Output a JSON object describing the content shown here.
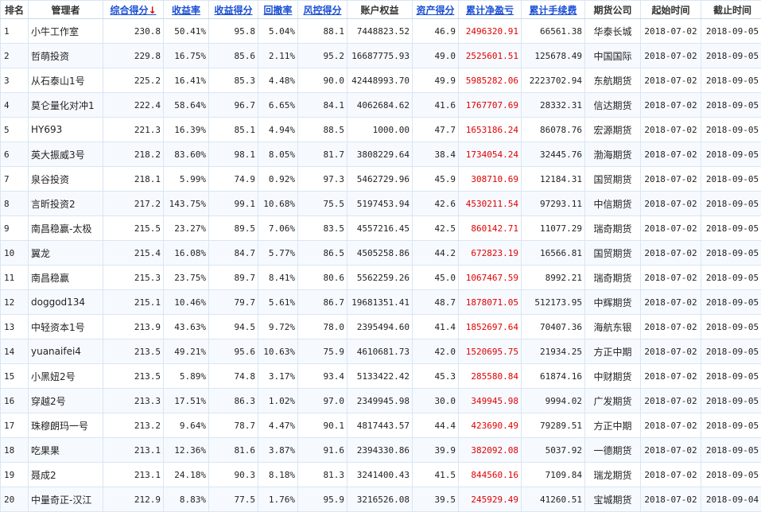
{
  "colors": {
    "accent": "#1a4fd6",
    "highlight": "#e00000",
    "row_alt": "#f6faff",
    "border": "#d9e6f2"
  },
  "table": {
    "headers": [
      {
        "label": "排名",
        "sortable": false
      },
      {
        "label": "管理者",
        "sortable": false
      },
      {
        "label": "综合得分",
        "sortable": true,
        "sort_arrow": "↓"
      },
      {
        "label": "收益率",
        "sortable": true
      },
      {
        "label": "收益得分",
        "sortable": true
      },
      {
        "label": "回撤率",
        "sortable": true
      },
      {
        "label": "风控得分",
        "sortable": true
      },
      {
        "label": "账户权益",
        "sortable": false
      },
      {
        "label": "资产得分",
        "sortable": true
      },
      {
        "label": "累计净盈亏",
        "sortable": true
      },
      {
        "label": "累计手续费",
        "sortable": true
      },
      {
        "label": "期货公司",
        "sortable": false
      },
      {
        "label": "起始时间",
        "sortable": false
      },
      {
        "label": "截止时间",
        "sortable": false
      }
    ],
    "rows": [
      [
        "1",
        "小牛工作室",
        "230.8",
        "50.41%",
        "95.8",
        "5.04%",
        "88.1",
        "7448823.52",
        "46.9",
        "2496320.91",
        "66561.38",
        "华泰长城",
        "2018-07-02",
        "2018-09-05"
      ],
      [
        "2",
        "哲萌投资",
        "229.8",
        "16.75%",
        "85.6",
        "2.11%",
        "95.2",
        "16687775.93",
        "49.0",
        "2525601.51",
        "125678.49",
        "中国国际",
        "2018-07-02",
        "2018-09-05"
      ],
      [
        "3",
        "从石泰山1号",
        "225.2",
        "16.41%",
        "85.3",
        "4.48%",
        "90.0",
        "42448993.70",
        "49.9",
        "5985282.06",
        "2223702.94",
        "东航期货",
        "2018-07-02",
        "2018-09-05"
      ],
      [
        "4",
        "莫仑量化对冲1",
        "222.4",
        "58.64%",
        "96.7",
        "6.65%",
        "84.1",
        "4062684.62",
        "41.6",
        "1767707.69",
        "28332.31",
        "信达期货",
        "2018-07-02",
        "2018-09-05"
      ],
      [
        "5",
        "HY693",
        "221.3",
        "16.39%",
        "85.1",
        "4.94%",
        "88.5",
        "1000.00",
        "47.7",
        "1653186.24",
        "86078.76",
        "宏源期货",
        "2018-07-02",
        "2018-09-05"
      ],
      [
        "6",
        "英大振威3号",
        "218.2",
        "83.60%",
        "98.1",
        "8.05%",
        "81.7",
        "3808229.64",
        "38.4",
        "1734054.24",
        "32445.76",
        "渤海期货",
        "2018-07-02",
        "2018-09-05"
      ],
      [
        "7",
        "泉谷投资",
        "218.1",
        "5.99%",
        "74.9",
        "0.92%",
        "97.3",
        "5462729.96",
        "45.9",
        "308710.69",
        "12184.31",
        "国贸期货",
        "2018-07-02",
        "2018-09-05"
      ],
      [
        "8",
        "言昕投资2",
        "217.2",
        "143.75%",
        "99.1",
        "10.68%",
        "75.5",
        "5197453.94",
        "42.6",
        "4530211.54",
        "97293.11",
        "中信期货",
        "2018-07-02",
        "2018-09-05"
      ],
      [
        "9",
        "南昌稳赢-太极",
        "215.5",
        "23.27%",
        "89.5",
        "7.06%",
        "83.5",
        "4557216.45",
        "42.5",
        "860142.71",
        "11077.29",
        "瑞奇期货",
        "2018-07-02",
        "2018-09-05"
      ],
      [
        "10",
        "翼龙",
        "215.4",
        "16.08%",
        "84.7",
        "5.77%",
        "86.5",
        "4505258.86",
        "44.2",
        "672823.19",
        "16566.81",
        "国贸期货",
        "2018-07-02",
        "2018-09-05"
      ],
      [
        "11",
        "南昌稳赢",
        "215.3",
        "23.75%",
        "89.7",
        "8.41%",
        "80.6",
        "5562259.26",
        "45.0",
        "1067467.59",
        "8992.21",
        "瑞奇期货",
        "2018-07-02",
        "2018-09-05"
      ],
      [
        "12",
        "doggod134",
        "215.1",
        "10.46%",
        "79.7",
        "5.61%",
        "86.7",
        "19681351.41",
        "48.7",
        "1878071.05",
        "512173.95",
        "中辉期货",
        "2018-07-02",
        "2018-09-05"
      ],
      [
        "13",
        "中轻资本1号",
        "213.9",
        "43.63%",
        "94.5",
        "9.72%",
        "78.0",
        "2395494.60",
        "41.4",
        "1852697.64",
        "70407.36",
        "海航东银",
        "2018-07-02",
        "2018-09-05"
      ],
      [
        "14",
        "yuanaifei4",
        "213.5",
        "49.21%",
        "95.6",
        "10.63%",
        "75.9",
        "4610681.73",
        "42.0",
        "1520695.75",
        "21934.25",
        "方正中期",
        "2018-07-02",
        "2018-09-05"
      ],
      [
        "15",
        "小黑妞2号",
        "213.5",
        "5.89%",
        "74.8",
        "3.17%",
        "93.4",
        "5133422.42",
        "45.3",
        "285580.84",
        "61874.16",
        "中财期货",
        "2018-07-02",
        "2018-09-05"
      ],
      [
        "16",
        "穿越2号",
        "213.3",
        "17.51%",
        "86.3",
        "1.02%",
        "97.0",
        "2349945.98",
        "30.0",
        "349945.98",
        "9994.02",
        "广发期货",
        "2018-07-02",
        "2018-09-05"
      ],
      [
        "17",
        "珠穆朗玛一号",
        "213.2",
        "9.64%",
        "78.7",
        "4.47%",
        "90.1",
        "4817443.57",
        "44.4",
        "423690.49",
        "79289.51",
        "方正中期",
        "2018-07-02",
        "2018-09-05"
      ],
      [
        "18",
        "吃果果",
        "213.1",
        "12.36%",
        "81.6",
        "3.87%",
        "91.6",
        "2394330.86",
        "39.9",
        "382092.08",
        "5037.92",
        "一德期货",
        "2018-07-02",
        "2018-09-05"
      ],
      [
        "19",
        "聂成2",
        "213.1",
        "24.18%",
        "90.3",
        "8.18%",
        "81.3",
        "3241400.43",
        "41.5",
        "844560.16",
        "7109.84",
        "瑞龙期货",
        "2018-07-02",
        "2018-09-05"
      ],
      [
        "20",
        "中量奇正-汉江",
        "212.9",
        "8.83%",
        "77.5",
        "1.76%",
        "95.9",
        "3216526.08",
        "39.5",
        "245929.49",
        "41260.51",
        "宝城期货",
        "2018-07-02",
        "2018-09-04"
      ]
    ]
  }
}
